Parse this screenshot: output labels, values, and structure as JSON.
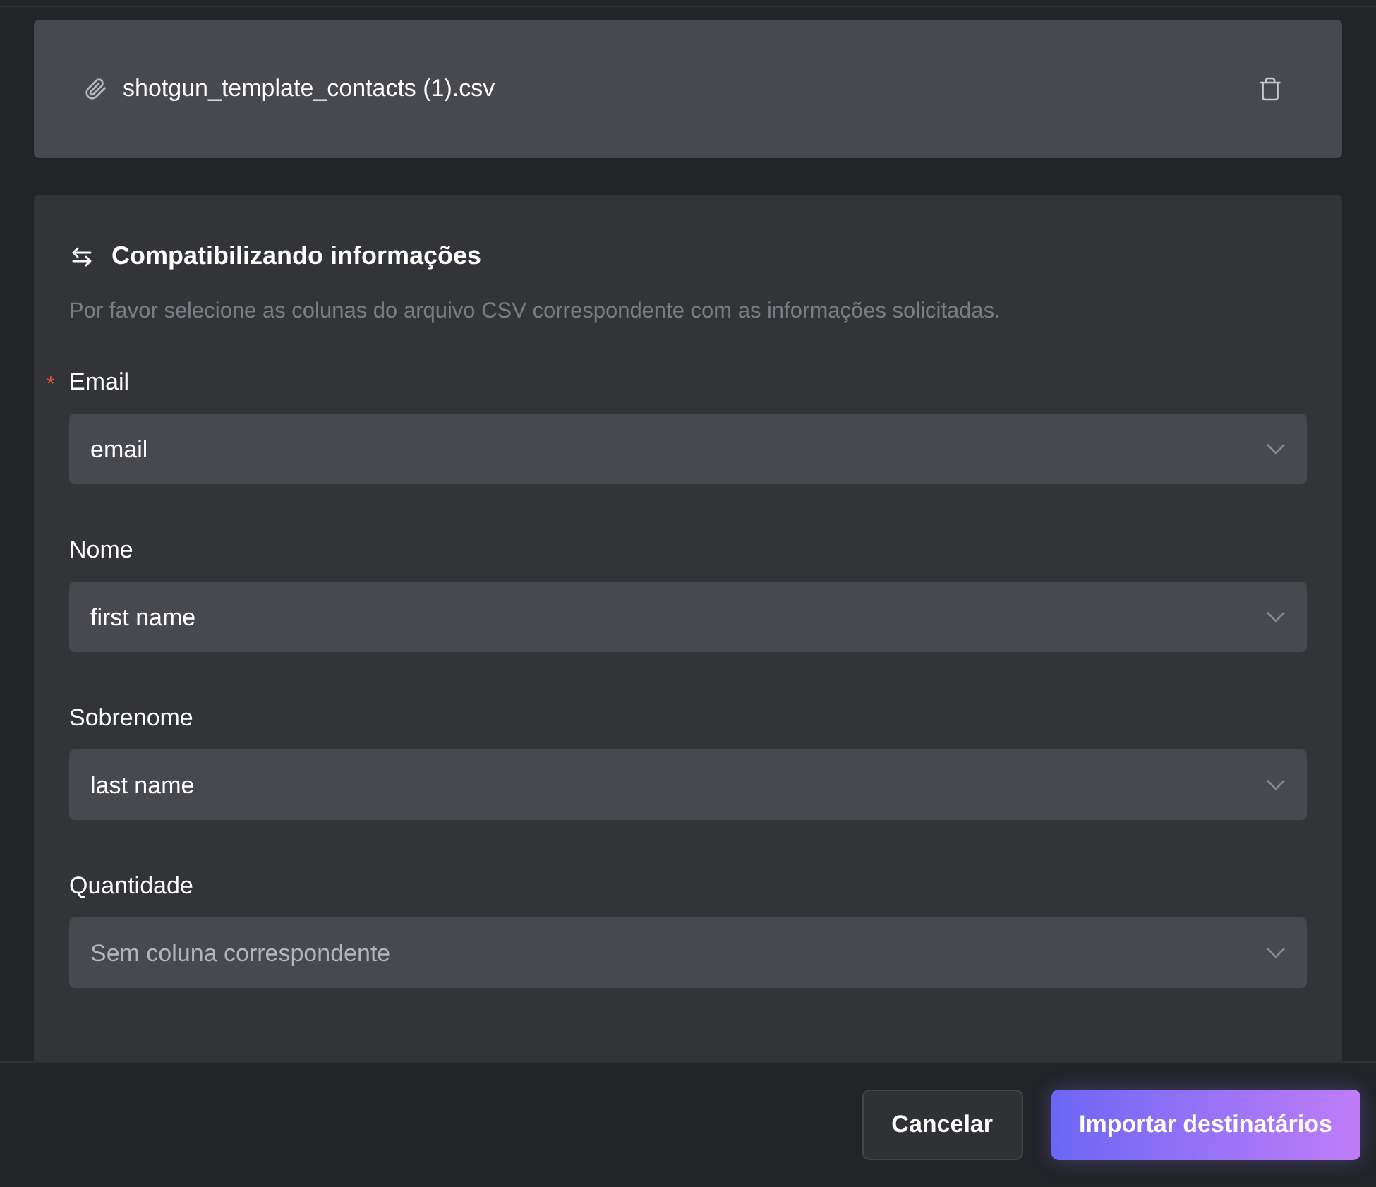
{
  "file": {
    "name": "shotgun_template_contacts (1).csv"
  },
  "mapping": {
    "title": "Compatibilizando informações",
    "description": "Por favor selecione as colunas do arquivo CSV correspondente com as informações solicitadas.",
    "fields": [
      {
        "label": "Email",
        "required_mark": "*",
        "value": "email"
      },
      {
        "label": "Nome",
        "value": "first name"
      },
      {
        "label": "Sobrenome",
        "value": "last name"
      },
      {
        "label": "Quantidade",
        "placeholder": "Sem coluna correspondente"
      }
    ]
  },
  "footer": {
    "cancel": "Cancelar",
    "submit": "Importar destinatários"
  }
}
